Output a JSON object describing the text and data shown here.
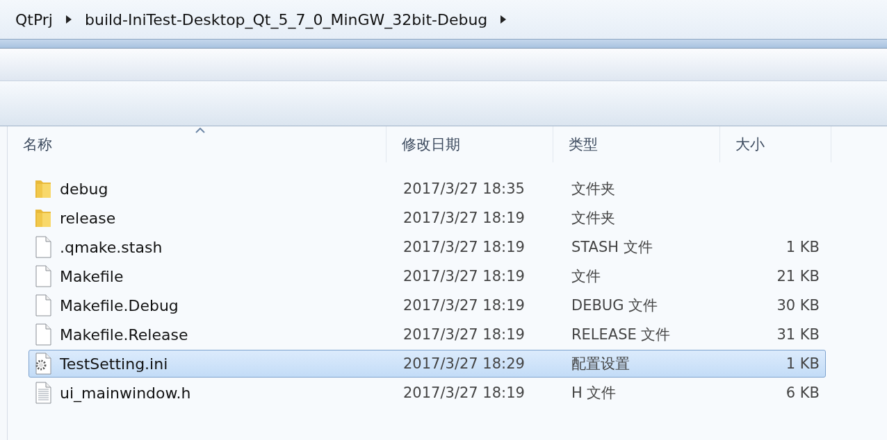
{
  "breadcrumb": [
    "QtPrj",
    "build-IniTest-Desktop_Qt_5_7_0_MinGW_32bit-Debug"
  ],
  "table": {
    "columns": [
      {
        "label": "名称",
        "sorted": true
      },
      {
        "label": "修改日期",
        "sorted": false
      },
      {
        "label": "类型",
        "sorted": false
      },
      {
        "label": "大小",
        "sorted": false
      }
    ],
    "rows": [
      {
        "kind": "folder",
        "name": "debug",
        "modified": "2017/3/27 18:35",
        "type": "文件夹",
        "size": "",
        "selected": false
      },
      {
        "kind": "folder",
        "name": "release",
        "modified": "2017/3/27 18:19",
        "type": "文件夹",
        "size": "",
        "selected": false
      },
      {
        "kind": "file",
        "name": ".qmake.stash",
        "modified": "2017/3/27 18:19",
        "type": "STASH 文件",
        "size": "1 KB",
        "selected": false
      },
      {
        "kind": "file",
        "name": "Makefile",
        "modified": "2017/3/27 18:19",
        "type": "文件",
        "size": "21 KB",
        "selected": false
      },
      {
        "kind": "file",
        "name": "Makefile.Debug",
        "modified": "2017/3/27 18:19",
        "type": "DEBUG 文件",
        "size": "30 KB",
        "selected": false
      },
      {
        "kind": "file",
        "name": "Makefile.Release",
        "modified": "2017/3/27 18:19",
        "type": "RELEASE 文件",
        "size": "31 KB",
        "selected": false
      },
      {
        "kind": "settings",
        "name": "TestSetting.ini",
        "modified": "2017/3/27 18:29",
        "type": "配置设置",
        "size": "1 KB",
        "selected": true
      },
      {
        "kind": "text",
        "name": "ui_mainwindow.h",
        "modified": "2017/3/27 18:19",
        "type": "H 文件",
        "size": "6 KB",
        "selected": false
      }
    ]
  }
}
